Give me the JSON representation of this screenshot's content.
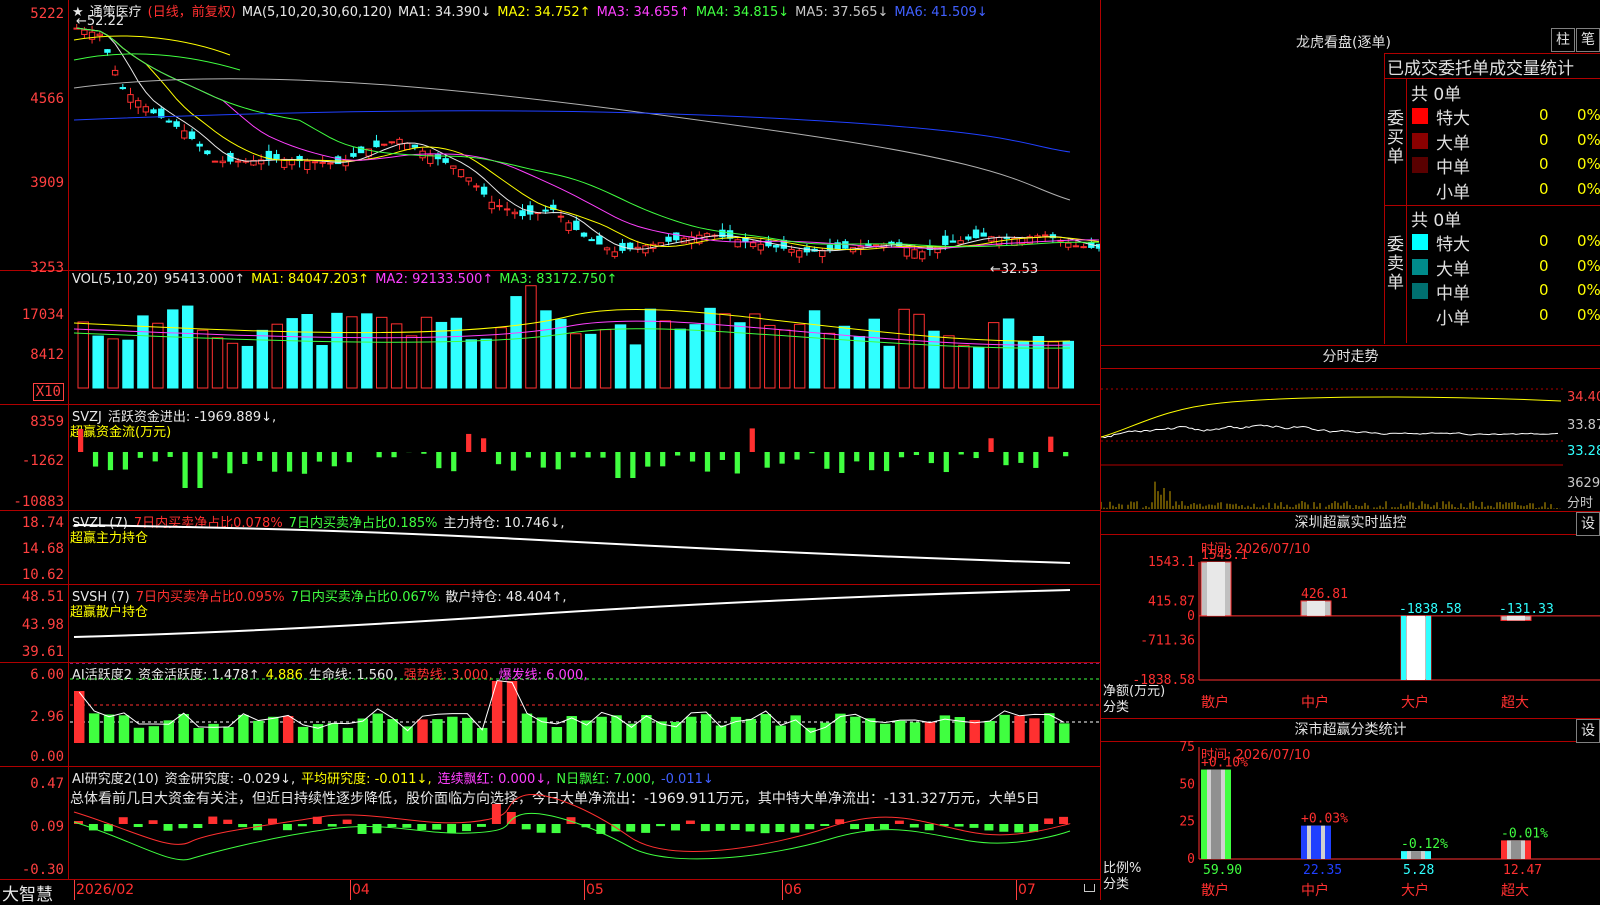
{
  "stock": {
    "star": "★",
    "name": "通策医疗",
    "mode": "(日线，前复权)"
  },
  "price_panel": {
    "ma_label": "MA(5,10,20,30,60,120)",
    "ma_values": [
      {
        "label": "MA1:",
        "value": "34.390↓",
        "color": "#e8e8e8"
      },
      {
        "label": "MA2:",
        "value": "34.752↑",
        "color": "#ffff00"
      },
      {
        "label": "MA3:",
        "value": "34.655↑",
        "color": "#ff40ff"
      },
      {
        "label": "MA4:",
        "value": "34.815↓",
        "color": "#40ff40"
      },
      {
        "label": "MA5:",
        "value": "37.565↓",
        "color": "#c8c8c8"
      },
      {
        "label": "MA6:",
        "value": "41.509↓",
        "color": "#4060ff"
      }
    ],
    "y_labels": [
      "5222",
      "4566",
      "3909",
      "3253"
    ],
    "high_label": "←52.22",
    "low_label": "←32.53"
  },
  "vol_panel": {
    "title": "VOL(5,10,20)",
    "value": "95413.000↑",
    "ma1": "MA1: 84047.203↑",
    "ma2": "MA2: 92133.500↑",
    "ma3": "MA3: 83172.750↑",
    "y_labels": [
      "17034",
      "8412"
    ],
    "unit": "X10"
  },
  "svzj_panel": {
    "title": "SVZJ",
    "text": "活跃资金进出: -1969.889↓,",
    "sub": "超赢资金流(万元)",
    "y_labels": [
      "8359",
      "-1262",
      "-10883"
    ]
  },
  "svzl_panel": {
    "title": "SVZL (7)",
    "t1": "7日内买卖净占比0.078%",
    "t2": "7日内买卖净占比0.185%",
    "t3": "主力持仓: 10.746↓,",
    "sub": "超赢主力持仓",
    "y_labels": [
      "18.74",
      "14.68",
      "10.62"
    ]
  },
  "svsh_panel": {
    "title": "SVSH (7)",
    "t1": "7日内买卖净占比0.095%",
    "t2": "7日内买卖净占比0.067%",
    "t3": "散户持仓: 48.404↑,",
    "sub": "超赢散户持仓",
    "y_labels": [
      "48.51",
      "43.98",
      "39.61"
    ]
  },
  "ai_active_panel": {
    "title": "AI活跃度2",
    "t1": "资金活跃度: 1.478↑",
    "t2": "4.886",
    "t3": "生命线: 1.560,",
    "t4": "强势线: 3.000,",
    "t5": "爆发线: 6.000,",
    "y_labels": [
      "6.00",
      "2.96",
      "0.00"
    ]
  },
  "ai_research_panel": {
    "title": "AI研究度2(10)",
    "t1": "资金研究度: -0.029↓,",
    "t2": "平均研究度: -0.011↓,",
    "t3": "连续飘红: 0.000↓,",
    "t4": "N日飘红: 7.000,",
    "t5": "-0.011↓",
    "summary": "总体看前几日大资金有关注，但近日持续性逐步降低，股价面临方向选择，今日大单净流出：-1969.911万元，其中特大单净流出：-131.327万元，大单5日",
    "y_labels": [
      "0.47",
      "0.09",
      "-0.30"
    ]
  },
  "x_axis": {
    "brand": "大智慧",
    "labels": [
      "2026/02",
      "04",
      "05",
      "06",
      "07"
    ]
  },
  "dragon_tiger": {
    "title": "龙虎看盘(逐单)",
    "btn1": "柱",
    "btn2": "笔",
    "header": "已成交委托单成交量统计",
    "buy": {
      "label": "委买单",
      "total": "共 0单",
      "rows": [
        {
          "name": "特大",
          "count": "0",
          "pct": "0%",
          "color": "#ff0000"
        },
        {
          "name": "大单",
          "count": "0",
          "pct": "0%",
          "color": "#8b0000"
        },
        {
          "name": "中单",
          "count": "0",
          "pct": "0%",
          "color": "#5a0000"
        },
        {
          "name": "小单",
          "count": "0",
          "pct": "0%",
          "color": "#000000"
        }
      ]
    },
    "sell": {
      "label": "委卖单",
      "total": "共 0单",
      "rows": [
        {
          "name": "特大",
          "count": "0",
          "pct": "0%",
          "color": "#00ffff"
        },
        {
          "name": "大单",
          "count": "0",
          "pct": "0%",
          "color": "#008b8b"
        },
        {
          "name": "中单",
          "count": "0",
          "pct": "0%",
          "color": "#007070"
        },
        {
          "name": "小单",
          "count": "0",
          "pct": "0%",
          "color": "#000000"
        }
      ]
    }
  },
  "intraday": {
    "title": "分时走势",
    "y_labels": [
      "34.40",
      "33.87",
      "33.28"
    ],
    "vol_label": "3629",
    "vol_unit": "分时"
  },
  "sz_monitor": {
    "title": "深圳超赢实时监控",
    "btn": "设",
    "time": "时间: 2026/07/10",
    "y_labels": [
      "1543.1",
      "415.87",
      "0",
      "-711.36",
      "-1838.58"
    ],
    "axis_title": "净额(万元)",
    "axis_sub": "分类",
    "categories": [
      "散户",
      "中户",
      "大户",
      "超大"
    ],
    "values": [
      1543.1,
      426.81,
      -1838.58,
      -131.33
    ],
    "value_labels": [
      "1543.1",
      "426.81",
      "-1838.58",
      "-131.33"
    ]
  },
  "sz_classify": {
    "title": "深市超赢分类统计",
    "btn": "设",
    "time": "时间: 2026/07/10",
    "y_labels": [
      "75",
      "50",
      "25",
      "0"
    ],
    "axis_title": "比例%",
    "axis_sub": "分类",
    "categories": [
      "散户",
      "中户",
      "大户",
      "超大"
    ],
    "values": [
      59.9,
      22.35,
      5.28,
      12.47
    ],
    "changes": [
      "+0.10%",
      "+0.03%",
      "-0.12%",
      "-0.01%"
    ],
    "value_labels": [
      "59.90",
      "22.35",
      "5.28",
      "12.47"
    ]
  }
}
